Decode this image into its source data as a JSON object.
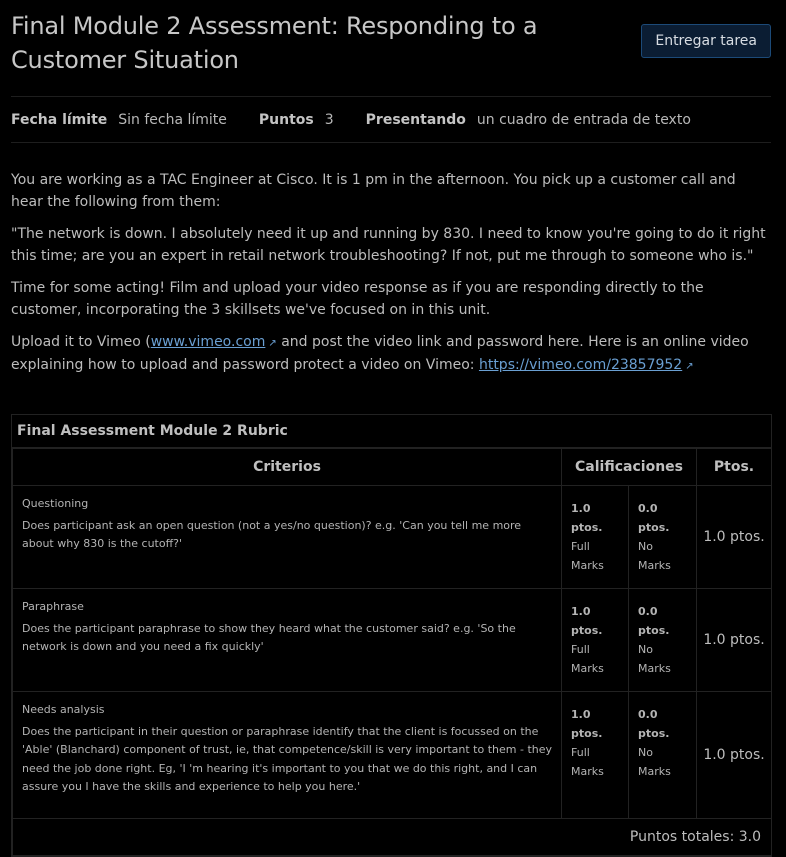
{
  "header": {
    "title": "Final Module 2 Assessment: Responding to a Customer Situation",
    "submit_label": "Entregar tarea"
  },
  "details": {
    "due_label": "Fecha límite",
    "due_value": "Sin fecha límite",
    "points_label": "Puntos",
    "points_value": "3",
    "submitting_label": "Presentando",
    "submitting_value": "un cuadro de entrada de texto"
  },
  "description": {
    "p1": "You are working as a TAC Engineer at Cisco. It is 1 pm in the afternoon. You pick up a customer call and hear the following from them:",
    "p2": "\"The network is down. I absolutely need it up and running by 830. I need to know you're going to do it right this time; are you an expert in retail network troubleshooting? If not, put me through to someone who is.\"",
    "p3": "Time for some acting! Film and upload your video response as if you are responding directly to the customer, incorporating the 3 skillsets we've focused on in this unit.",
    "p4_start": "Upload it to Vimeo (",
    "link1": "www.vimeo.com",
    "p4_mid": " and post the video link and password here. Here is an online video explaining how to upload and password protect a video on Vimeo: ",
    "link2": "https://vimeo.com/23857952"
  },
  "rubric": {
    "title": "Final Assessment Module 2 Rubric",
    "col_criteria": "Criterios",
    "col_ratings": "Calificaciones",
    "col_points": "Ptos.",
    "rows": [
      {
        "name": "Questioning",
        "desc": "Does participant ask an open question (not a yes/no question)? e.g. 'Can you tell me more about why 830 is the cutoff?'",
        "r1_pts": "1.0 ptos.",
        "r1_desc": "Full Marks",
        "r2_pts": "0.0 ptos.",
        "r2_desc": "No Marks",
        "points": "1.0 ptos."
      },
      {
        "name": "Paraphrase",
        "desc": "Does the participant paraphrase to show they heard what the customer said? e.g. 'So the network is down and you need a fix quickly'",
        "r1_pts": "1.0 ptos.",
        "r1_desc": "Full Marks",
        "r2_pts": "0.0 ptos.",
        "r2_desc": "No Marks",
        "points": "1.0 ptos."
      },
      {
        "name": "Needs analysis",
        "desc": "Does the participant in their question or paraphrase identify that the client is focussed on the 'Able' (Blanchard) component of trust, ie, that competence/skill is very important to them - they need the job done right. Eg, 'I 'm hearing it's important to you that we do this right, and I can assure you I have the skills and experience to help you here.'",
        "r1_pts": "1.0 ptos.",
        "r1_desc": "Full Marks",
        "r2_pts": "0.0 ptos.",
        "r2_desc": "No Marks",
        "points": "1.0 ptos."
      }
    ],
    "total": "Puntos totales: 3.0"
  },
  "icons": {
    "external_link": "external-link-icon"
  }
}
